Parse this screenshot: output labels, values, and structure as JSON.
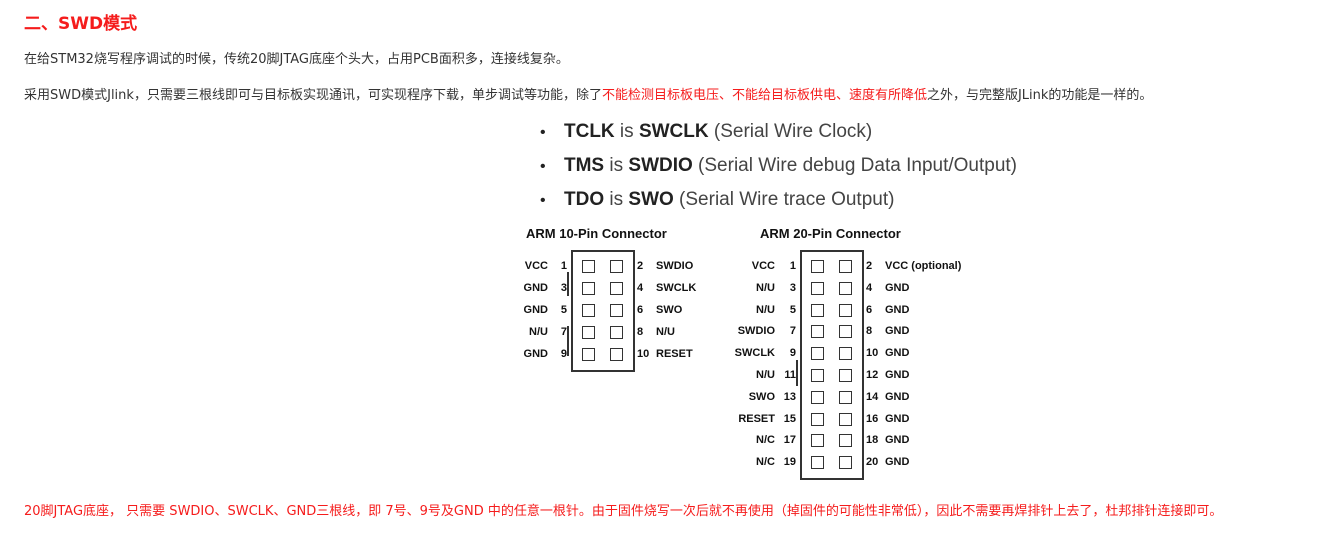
{
  "heading": "二、SWD模式",
  "para1": "在给STM32烧写程序调试的时候，传统20脚JTAG底座个头大，占用PCB面积多，连接线复杂。",
  "para2": {
    "before": "采用SWD模式Jlink，只需要三根线即可与目标板实现通讯，可实现程序下载，单步调试等功能，除了",
    "red": "不能检测目标板电压、不能给目标板供电、速度有所降低",
    "after": "之外，与完整版JLink的功能是一样的。"
  },
  "bullets": [
    {
      "jtag": "TCLK",
      "is": " is ",
      "swd": "SWCLK",
      "desc": " (Serial Wire Clock)"
    },
    {
      "jtag": "TMS",
      "is": " is ",
      "swd": "SWDIO",
      "desc": " (Serial Wire debug Data Input/Output)"
    },
    {
      "jtag": "TDO",
      "is": " is ",
      "swd": "SWO",
      "desc": " (Serial Wire trace Output)"
    }
  ],
  "conn10": {
    "title": "ARM 10-Pin Connector",
    "rows": [
      {
        "l": "VCC",
        "ln": "1",
        "rn": "2",
        "r": "SWDIO"
      },
      {
        "l": "GND",
        "ln": "3",
        "rn": "4",
        "r": "SWCLK"
      },
      {
        "l": "GND",
        "ln": "5",
        "rn": "6",
        "r": "SWO"
      },
      {
        "l": "N/U",
        "ln": "7",
        "rn": "8",
        "r": "N/U"
      },
      {
        "l": "GND",
        "ln": "9",
        "rn": "10",
        "r": "RESET"
      }
    ]
  },
  "conn20": {
    "title": "ARM 20-Pin Connector",
    "rows": [
      {
        "l": "VCC",
        "ln": "1",
        "rn": "2",
        "r": "VCC (optional)"
      },
      {
        "l": "N/U",
        "ln": "3",
        "rn": "4",
        "r": "GND"
      },
      {
        "l": "N/U",
        "ln": "5",
        "rn": "6",
        "r": "GND"
      },
      {
        "l": "SWDIO",
        "ln": "7",
        "rn": "8",
        "r": "GND"
      },
      {
        "l": "SWCLK",
        "ln": "9",
        "rn": "10",
        "r": "GND"
      },
      {
        "l": "N/U",
        "ln": "11",
        "rn": "12",
        "r": "GND"
      },
      {
        "l": "SWO",
        "ln": "13",
        "rn": "14",
        "r": "GND"
      },
      {
        "l": "RESET",
        "ln": "15",
        "rn": "16",
        "r": "GND"
      },
      {
        "l": "N/C",
        "ln": "17",
        "rn": "18",
        "r": "GND"
      },
      {
        "l": "N/C",
        "ln": "19",
        "rn": "20",
        "r": "GND"
      }
    ]
  },
  "para3": "20脚JTAG底座， 只需要 SWDIO、SWCLK、GND三根线，即 7号、9号及GND 中的任意一根针。由于固件烧写一次后就不再使用（掉固件的可能性非常低），因此不需要再焊排针上去了，杜邦排针连接即可。"
}
